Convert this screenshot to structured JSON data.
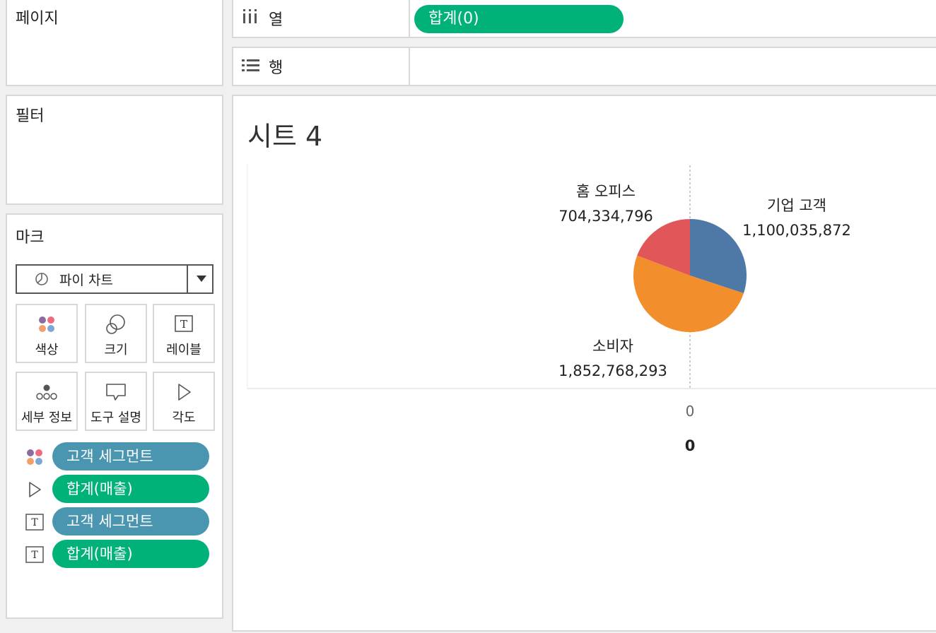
{
  "cards": {
    "pages_title": "페이지",
    "filters_title": "필터",
    "marks_title": "마크"
  },
  "marks": {
    "mark_type": "파이 차트",
    "buttons": {
      "color": "색상",
      "size": "크기",
      "label": "레이블",
      "detail": "세부 정보",
      "tooltip": "도구 설명",
      "angle": "각도"
    },
    "pills": [
      {
        "label": "고객 세그먼트",
        "kind": "dimension",
        "encoding": "color"
      },
      {
        "label": "합계(매출)",
        "kind": "measure",
        "encoding": "angle"
      },
      {
        "label": "고객 세그먼트",
        "kind": "dimension",
        "encoding": "label"
      },
      {
        "label": "합계(매출)",
        "kind": "measure",
        "encoding": "label"
      }
    ]
  },
  "shelves": {
    "columns_label": "열",
    "columns_pill": "합계(0)",
    "rows_label": "행"
  },
  "sheet": {
    "title": "시트 4"
  },
  "colors": {
    "dimension_pill": "#4a96b0",
    "measure_pill": "#00b17a",
    "corporate": "#4e79a7",
    "consumer": "#f28e2b",
    "home_office": "#e15759"
  },
  "chart_data": {
    "type": "pie",
    "categories": [
      "기업 고객",
      "소비자",
      "홈 오피스"
    ],
    "values": [
      1100035872,
      1852768293,
      704334796
    ],
    "value_labels": [
      "1,100,035,872",
      "1,852,768,293",
      "704,334,796"
    ],
    "colors": [
      "#4e79a7",
      "#f28e2b",
      "#e15759"
    ],
    "x_axis_tick": "0",
    "x_axis_title": "0"
  }
}
